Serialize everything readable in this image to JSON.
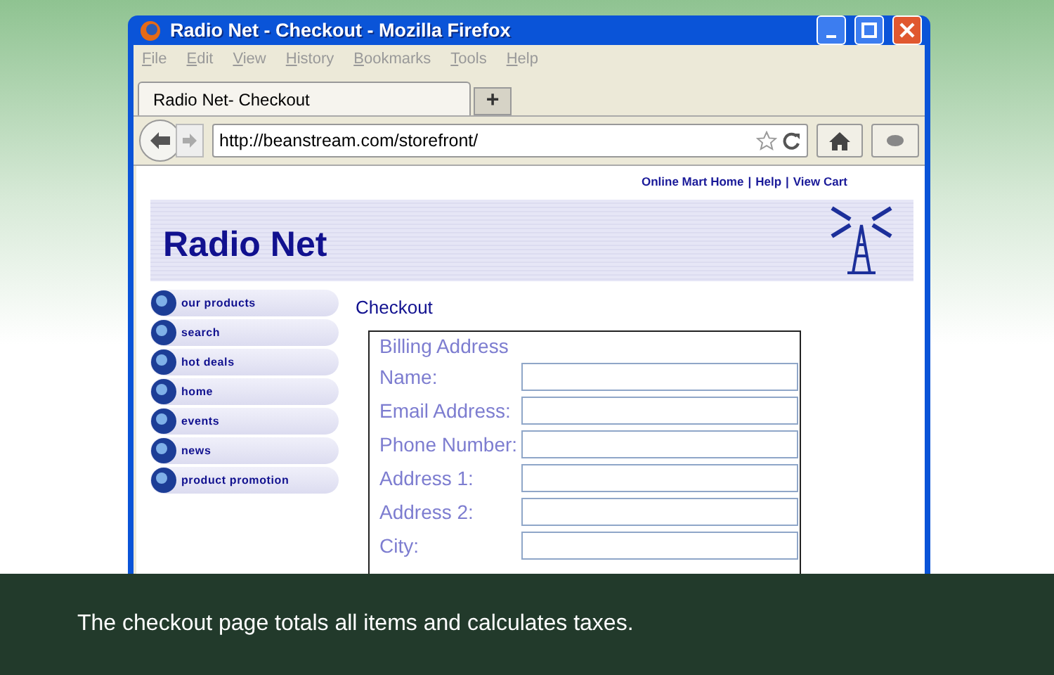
{
  "window": {
    "title": "Radio Net - Checkout - Mozilla Firefox"
  },
  "menu": [
    "File",
    "Edit",
    "View",
    "History",
    "Bookmarks",
    "Tools",
    "Help"
  ],
  "tabs": [
    {
      "label": "Radio Net- Checkout",
      "selected": true
    }
  ],
  "new_tab": "+",
  "address_bar": {
    "value": "http://beanstream.com/storefront/"
  },
  "top_links": [
    "Online Mart Home",
    "Help",
    "View Cart"
  ],
  "link_separator": "|",
  "banner": {
    "title": "Radio Net"
  },
  "sidebar": {
    "items": [
      {
        "label": "our products"
      },
      {
        "label": "search"
      },
      {
        "label": "hot deals"
      },
      {
        "label": "home"
      },
      {
        "label": "events"
      },
      {
        "label": "news"
      },
      {
        "label": "product promotion"
      }
    ]
  },
  "page_heading": "Checkout",
  "form": {
    "legend": "Billing Address",
    "fields": [
      {
        "label": "Name:"
      },
      {
        "label": "Email Address:"
      },
      {
        "label": "Phone Number:"
      },
      {
        "label": "Address 1:"
      },
      {
        "label": "Address 2:"
      },
      {
        "label": "City:"
      }
    ]
  },
  "caption": "The checkout page totals all items and calculates taxes."
}
